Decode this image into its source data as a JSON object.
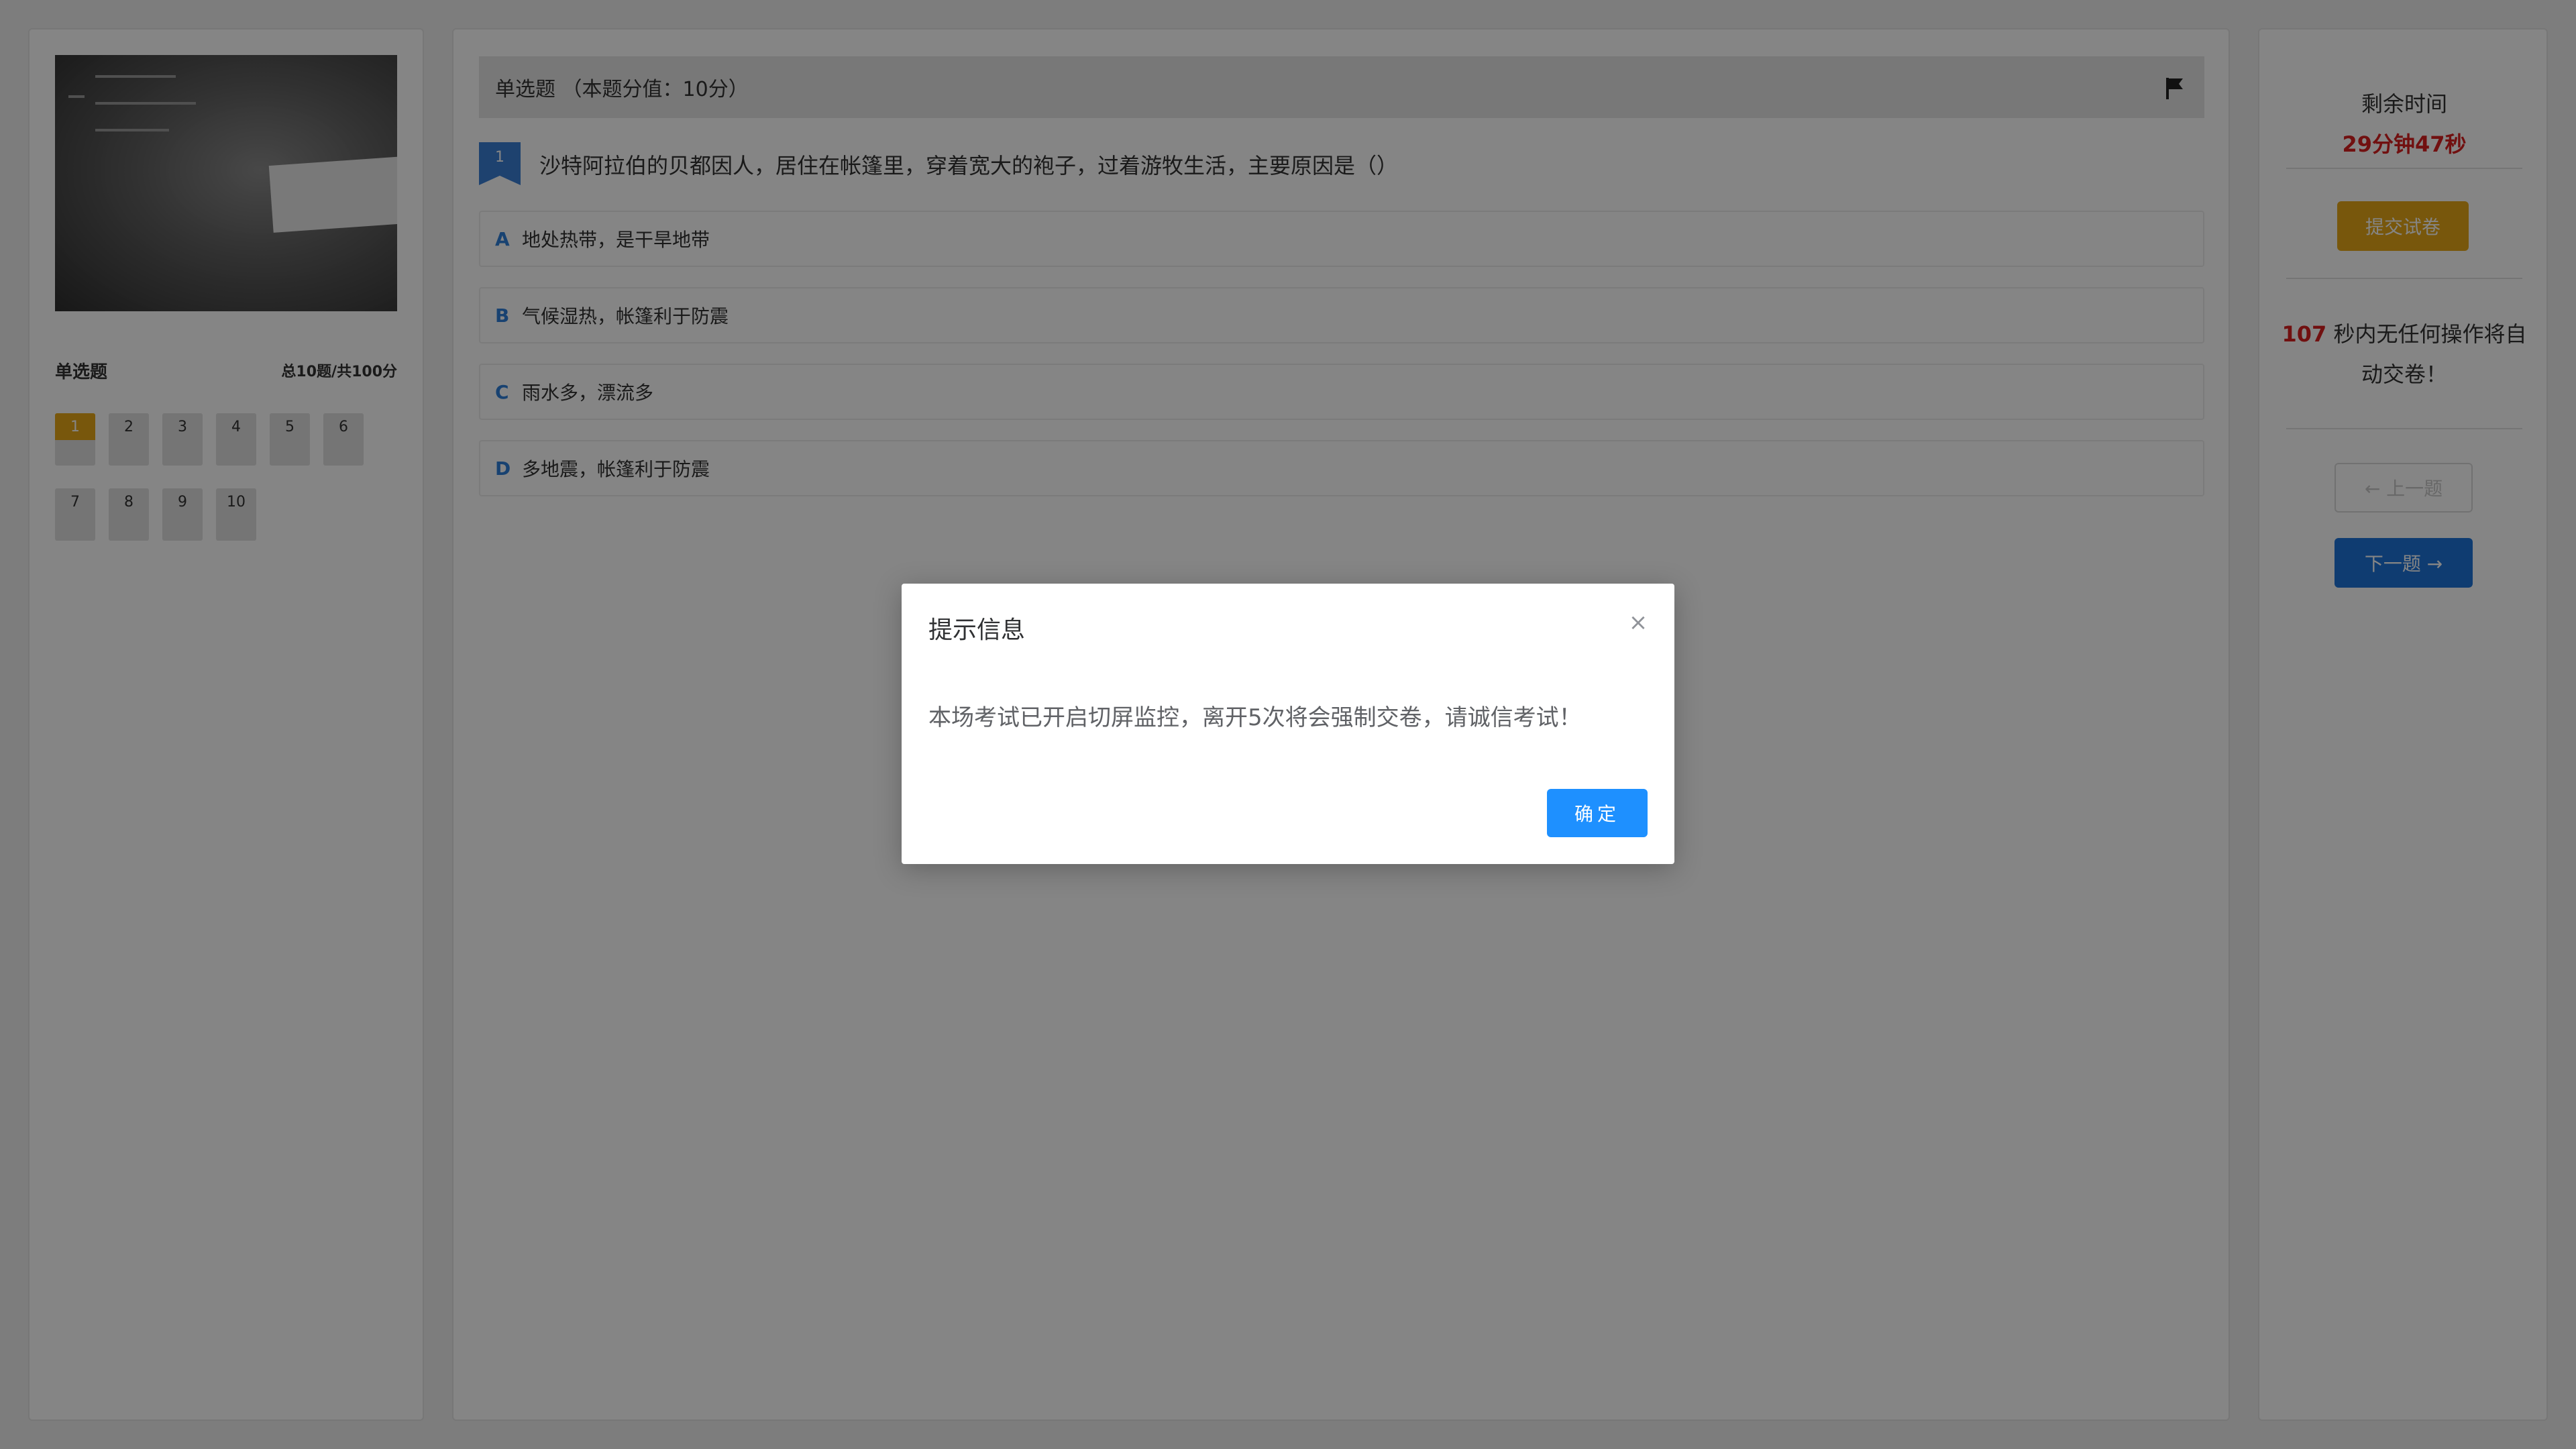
{
  "left": {
    "section_title": "单选题",
    "total": "总10题/共100分",
    "questions": [
      "1",
      "2",
      "3",
      "4",
      "5",
      "6",
      "7",
      "8",
      "9",
      "10"
    ],
    "active_question": "1"
  },
  "question": {
    "header": "单选题 （本题分值：10分）",
    "number": "1",
    "title": "沙特阿拉伯的贝都因人，居住在帐篷里，穿着宽大的袍子，过着游牧生活，主要原因是（）",
    "options": [
      {
        "letter": "A",
        "text": "地处热带，是干旱地带"
      },
      {
        "letter": "B",
        "text": "气候湿热，帐篷利于防震"
      },
      {
        "letter": "C",
        "text": "雨水多，漂流多"
      },
      {
        "letter": "D",
        "text": "多地震，帐篷利于防震"
      }
    ]
  },
  "right": {
    "remain_label": "剩余时间",
    "remain_time": "29分钟47秒",
    "submit_label": "提交试卷",
    "idle_seconds": "107",
    "idle_text": " 秒内无任何操作将自动交卷！",
    "prev_label": "← 上一题",
    "next_label": "下一题 →"
  },
  "modal": {
    "title": "提示信息",
    "close_glyph": "×",
    "body": "本场考试已开启切屏监控，离开5次将会强制交卷，请诚信考试！",
    "ok_label": "确定"
  },
  "colors": {
    "accent_orange": "#e6a817",
    "accent_blue": "#1d74d8",
    "warn_red": "#d92020",
    "modal_button": "#1e90ff"
  }
}
